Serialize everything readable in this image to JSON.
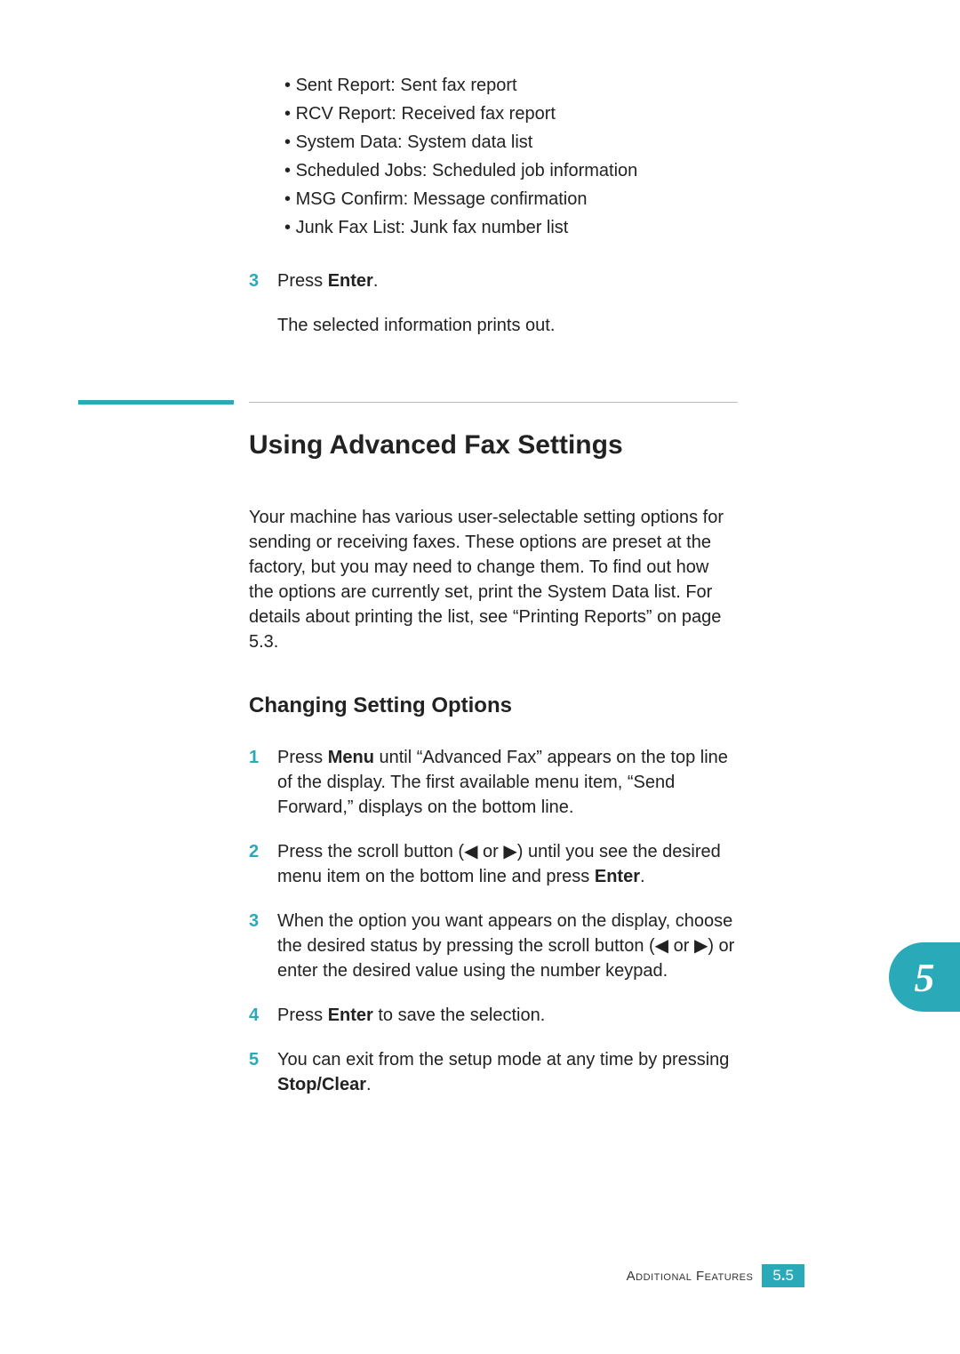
{
  "bullets": [
    "Sent Report: Sent fax report",
    "RCV Report: Received fax report",
    "System Data: System data list",
    "Scheduled Jobs: Scheduled job information",
    "MSG Confirm: Message confirmation",
    "Junk Fax List: Junk fax number list"
  ],
  "top_step": {
    "num": "3",
    "line_pre": "Press ",
    "line_bold": "Enter",
    "line_post": ".",
    "sub": "The selected information prints out."
  },
  "heading_main": "Using Advanced Fax Settings",
  "intro": "Your machine has various user-selectable setting options for sending or receiving faxes. These options are preset at the factory, but you may need to change them. To find out how the options are currently set, print the System Data list. For details about printing the list, see “Printing Reports” on page 5.3.",
  "heading_sub": "Changing Setting Options",
  "steps": [
    {
      "num": "1",
      "parts": [
        {
          "t": "Press "
        },
        {
          "t": "Menu",
          "b": true
        },
        {
          "t": " until “Advanced Fax” appears on the top line of the display. The first available menu item, “Send Forward,” displays on the bottom line."
        }
      ]
    },
    {
      "num": "2",
      "parts": [
        {
          "t": "Press the scroll button (◀ or ▶) until you see the desired menu item on the bottom line and press "
        },
        {
          "t": "Enter",
          "b": true
        },
        {
          "t": "."
        }
      ]
    },
    {
      "num": "3",
      "parts": [
        {
          "t": "When the option you want appears on the display, choose the desired status by pressing the scroll button (◀ or ▶) or enter the desired value using the number keypad."
        }
      ]
    },
    {
      "num": "4",
      "parts": [
        {
          "t": "Press "
        },
        {
          "t": "Enter",
          "b": true
        },
        {
          "t": " to save the selection."
        }
      ]
    },
    {
      "num": "5",
      "parts": [
        {
          "t": "You can exit from the setup mode at any time by pressing "
        },
        {
          "t": "Stop/Clear",
          "b": true
        },
        {
          "t": "."
        }
      ]
    }
  ],
  "chapter_tab": "5",
  "footer": {
    "label": "Additional Features",
    "page_major": "5",
    "page_sep": ".",
    "page_minor": "5"
  }
}
